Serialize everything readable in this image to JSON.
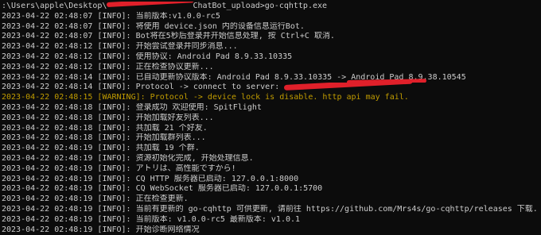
{
  "terminal": {
    "prompt": {
      "before": ":\\Users\\apple\\Desktop\\",
      "after": "ChatBot_upload>go-cqhttp.exe"
    },
    "lines": [
      {
        "time": "2023-04-22 02:48:07",
        "level": "[INFO]:",
        "msg": "当前版本:v1.0.0-rc5",
        "warn": false
      },
      {
        "time": "2023-04-22 02:48:07",
        "level": "[INFO]:",
        "msg": "将使用 device.json 内的设备信息运行Bot.",
        "warn": false
      },
      {
        "time": "2023-04-22 02:48:07",
        "level": "[INFO]:",
        "msg": "Bot将在5秒后登录并开始信息处理, 按 Ctrl+C 取消.",
        "warn": false
      },
      {
        "time": "2023-04-22 02:48:12",
        "level": "[INFO]:",
        "msg": "开始尝试登录并同步消息...",
        "warn": false
      },
      {
        "time": "2023-04-22 02:48:12",
        "level": "[INFO]:",
        "msg": "使用协议: Android Pad 8.9.33.10335",
        "warn": false
      },
      {
        "time": "2023-04-22 02:48:12",
        "level": "[INFO]:",
        "msg": "正在检查协议更新...",
        "warn": false
      },
      {
        "time": "2023-04-22 02:48:14",
        "level": "[INFO]:",
        "msg": "已自动更新协议版本: Android Pad 8.9.33.10335 -> Android Pad 8.9.38.10545",
        "warn": false
      },
      {
        "time": "2023-04-22 02:48:14",
        "level": "[INFO]:",
        "msg": "Protocol -> connect to server: ",
        "warn": false
      },
      {
        "time": "2023-04-22 02:48:15",
        "level": "[WARNING]:",
        "msg": "Protocol -> device lock is disable. http api may fail.",
        "warn": true
      },
      {
        "time": "2023-04-22 02:48:18",
        "level": "[INFO]:",
        "msg": "登录成功 欢迎使用: SpitFlight",
        "warn": false
      },
      {
        "time": "2023-04-22 02:48:18",
        "level": "[INFO]:",
        "msg": "开始加载好友列表...",
        "warn": false
      },
      {
        "time": "2023-04-22 02:48:18",
        "level": "[INFO]:",
        "msg": "共加载 21 个好友.",
        "warn": false
      },
      {
        "time": "2023-04-22 02:48:18",
        "level": "[INFO]:",
        "msg": "开始加载群列表...",
        "warn": false
      },
      {
        "time": "2023-04-22 02:48:19",
        "level": "[INFO]:",
        "msg": "共加载 19 个群.",
        "warn": false
      },
      {
        "time": "2023-04-22 02:48:19",
        "level": "[INFO]:",
        "msg": "资源初始化完成, 开始处理信息.",
        "warn": false
      },
      {
        "time": "2023-04-22 02:48:19",
        "level": "[INFO]:",
        "msg": "アトリは、高性能ですから!",
        "warn": false
      },
      {
        "time": "2023-04-22 02:48:19",
        "level": "[INFO]:",
        "msg": "CQ HTTP 服务器已启动: 127.0.0.1:8000",
        "warn": false
      },
      {
        "time": "2023-04-22 02:48:19",
        "level": "[INFO]:",
        "msg": "CQ WebSocket 服务器已启动: 127.0.0.1:5700",
        "warn": false
      },
      {
        "time": "2023-04-22 02:48:19",
        "level": "[INFO]:",
        "msg": "正在检查更新.",
        "warn": false
      },
      {
        "time": "2023-04-22 02:48:19",
        "level": "[INFO]:",
        "msg": "当前有更新的 go-cqhttp 可供更新, 请前往 https://github.com/Mrs4s/go-cqhttp/releases 下载.",
        "warn": false
      },
      {
        "time": "2023-04-22 02:48:19",
        "level": "[INFO]:",
        "msg": "当前版本: v1.0.0-rc5 最新版本: v1.0.1",
        "warn": false
      },
      {
        "time": "2023-04-22 02:48:19",
        "level": "[INFO]:",
        "msg": "开始诊断网络情况",
        "warn": false
      },
      {
        "time": "2023-04-22 02:48:22",
        "level": "[INFO]:",
        "msg": "网络诊断完成. 未发现问题",
        "warn": false
      }
    ]
  }
}
